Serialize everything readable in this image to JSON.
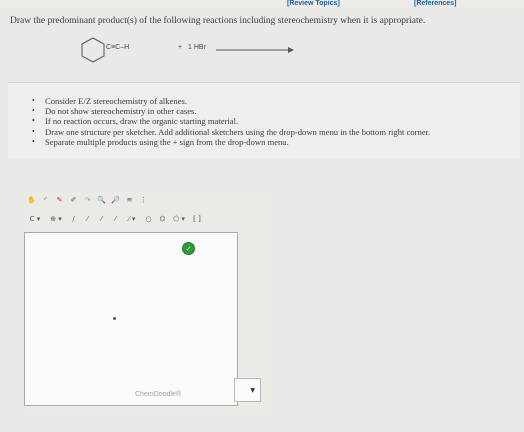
{
  "header": {
    "review_link": "[Review Topics]",
    "references_link": "[References]"
  },
  "question": {
    "text": "Draw the predominant product(s) of the following reactions including stereochemistry when it is appropriate."
  },
  "reaction": {
    "reactant_label": "C≡C–H",
    "plus": "+",
    "reagent": "1 HBr"
  },
  "instructions": [
    "Consider E/Z stereochemistry of alkenes.",
    "Do not show stereochemistry in other cases.",
    "If no reaction occurs, draw the organic starting material.",
    "Draw one structure per sketcher. Add additional sketchers using the drop-down menu in the bottom right corner.",
    "Separate multiple products using the + sign from the drop-down menu."
  ],
  "sketcher": {
    "row1_tools": [
      "hand-icon",
      "lasso-icon",
      "eraser-icon",
      "pencil-icon",
      "redo-icon",
      "zoom-in-icon",
      "zoom-out-icon",
      "clean-icon",
      "period-icon"
    ],
    "row2_tools": [
      "C ▾",
      "⊕ ▾",
      "/",
      "⁄",
      "⁄",
      "⁄",
      "⁄ ▾",
      "○",
      "⌬",
      "⬠ ▾",
      "[ ]"
    ],
    "watermark": "ChemDoodle®"
  }
}
